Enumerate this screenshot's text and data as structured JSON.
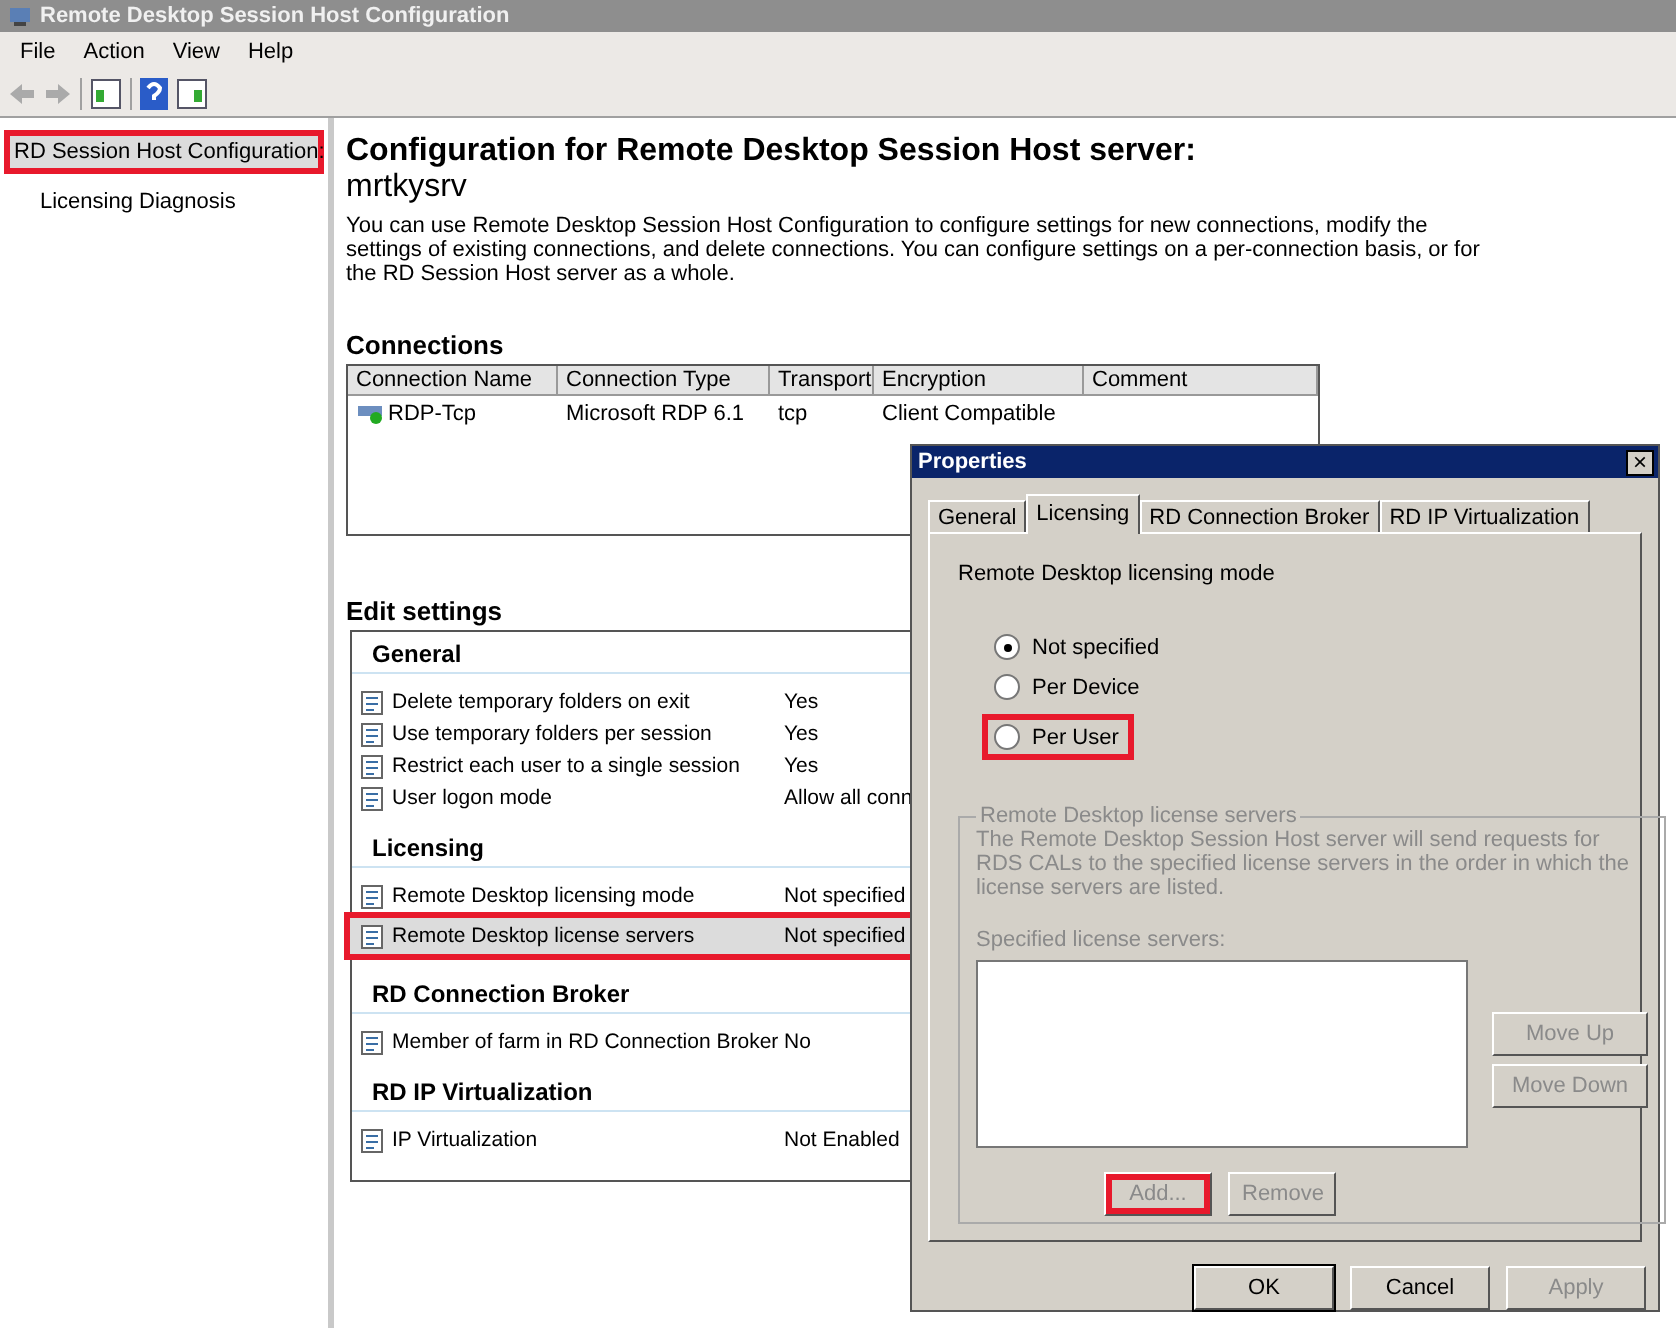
{
  "window": {
    "title": "Remote Desktop Session Host Configuration"
  },
  "menu": [
    "File",
    "Action",
    "View",
    "Help"
  ],
  "tree": [
    {
      "label": "RD Session Host Configuration:",
      "selected": true,
      "highlighted": true,
      "children": [
        {
          "label": "Licensing Diagnosis",
          "selected": false,
          "highlighted": false
        }
      ]
    }
  ],
  "header": {
    "title": "Configuration for Remote Desktop Session Host server:",
    "server": "mrtkysrv",
    "description": "You can use Remote Desktop Session Host Configuration to configure settings for new connections, modify the settings of existing connections, and delete connections. You can configure settings on a per-connection basis, or for the RD Session Host server as a whole."
  },
  "connections": {
    "title": "Connections",
    "columns": [
      "Connection Name",
      "Connection Type",
      "Transport",
      "Encryption",
      "Comment"
    ],
    "rows": [
      [
        "RDP-Tcp",
        "Microsoft RDP 6.1",
        "tcp",
        "Client Compatible",
        ""
      ]
    ]
  },
  "edit_settings": {
    "title": "Edit settings",
    "sections": [
      {
        "title": "General",
        "items": [
          {
            "label": "Delete temporary folders on exit",
            "value": "Yes",
            "highlighted": false
          },
          {
            "label": "Use temporary folders per session",
            "value": "Yes",
            "highlighted": false
          },
          {
            "label": "Restrict each user to a single session",
            "value": "Yes",
            "highlighted": false
          },
          {
            "label": "User logon mode",
            "value": "Allow all conn",
            "highlighted": false
          }
        ]
      },
      {
        "title": "Licensing",
        "items": [
          {
            "label": "Remote Desktop licensing mode",
            "value": "Not specified",
            "highlighted": false
          },
          {
            "label": "Remote Desktop license servers",
            "value": "Not specified",
            "highlighted": true,
            "selected": true
          }
        ]
      },
      {
        "title": "RD Connection Broker",
        "items": [
          {
            "label": "Member of farm in RD Connection Broker",
            "value": "No",
            "highlighted": false
          }
        ]
      },
      {
        "title": "RD IP Virtualization",
        "items": [
          {
            "label": "IP Virtualization",
            "value": "Not Enabled",
            "highlighted": false
          }
        ]
      }
    ]
  },
  "dialog": {
    "title": "Properties",
    "close": "×",
    "tabs": [
      {
        "label": "General",
        "selected": false
      },
      {
        "label": "Licensing",
        "selected": true
      },
      {
        "label": "RD Connection Broker",
        "selected": false
      },
      {
        "label": "RD IP Virtualization",
        "selected": false
      }
    ],
    "mode_label": "Remote Desktop licensing mode",
    "modes": [
      {
        "label": "Not specified",
        "selected": true,
        "highlighted": false
      },
      {
        "label": "Per Device",
        "selected": false,
        "highlighted": false
      },
      {
        "label": "Per User",
        "selected": false,
        "highlighted": true
      }
    ],
    "servers_group": {
      "title": "Remote Desktop license servers",
      "disabled": true,
      "description": "The Remote Desktop Session Host server will send requests for RDS CALs to the specified license servers in the order in which the license servers are listed.",
      "list_label": "Specified license servers:",
      "side_buttons": [
        {
          "label": "Move Up",
          "disabled": true
        },
        {
          "label": "Move Down",
          "disabled": true
        }
      ],
      "buttons": [
        {
          "label": "Add...",
          "disabled": true,
          "highlighted": true
        },
        {
          "label": "Remove",
          "disabled": true,
          "highlighted": false
        }
      ]
    },
    "buttons": [
      {
        "label": "OK",
        "disabled": false,
        "default": true
      },
      {
        "label": "Cancel",
        "disabled": false,
        "default": false
      },
      {
        "label": "Apply",
        "disabled": true,
        "default": false
      }
    ]
  }
}
